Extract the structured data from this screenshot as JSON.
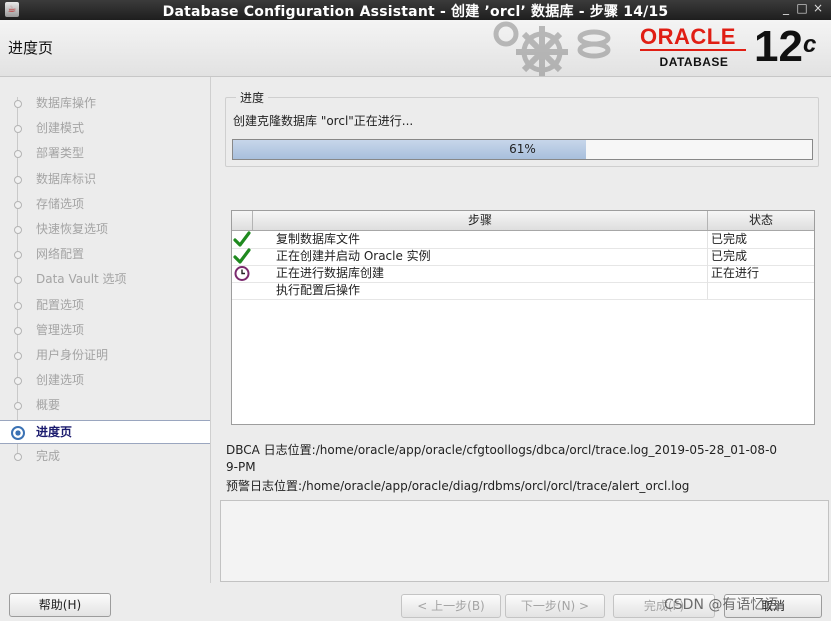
{
  "window": {
    "title": "Database Configuration Assistant - 创建 ’orcl’ 数据库 - 步骤 14/15",
    "min": "_",
    "max": "□",
    "close": "×"
  },
  "header": {
    "page_title": "进度页",
    "brand": "ORACLE",
    "product": "DATABASE",
    "version": "12",
    "version_suffix": "c"
  },
  "sidebar": {
    "items": [
      {
        "label": "数据库操作"
      },
      {
        "label": "创建模式"
      },
      {
        "label": "部署类型"
      },
      {
        "label": "数据库标识"
      },
      {
        "label": "存储选项"
      },
      {
        "label": "快速恢复选项"
      },
      {
        "label": "网络配置"
      },
      {
        "label": "Data Vault 选项"
      },
      {
        "label": "配置选项"
      },
      {
        "label": "管理选项"
      },
      {
        "label": "用户身份证明"
      },
      {
        "label": "创建选项"
      },
      {
        "label": "概要"
      },
      {
        "label": "进度页"
      },
      {
        "label": "完成"
      }
    ],
    "active_index": 13
  },
  "progress": {
    "legend": "进度",
    "status": "创建克隆数据库 \"orcl\"正在进行...",
    "percent_label": "61%",
    "fraction": 0.61
  },
  "steps_table": {
    "headers": {
      "step": "步骤",
      "status": "状态"
    },
    "rows": [
      {
        "name": "复制数据库文件",
        "status": "已完成",
        "icon": "check-icon"
      },
      {
        "name": "正在创建并启动 Oracle 实例",
        "status": "已完成",
        "icon": "check-icon"
      },
      {
        "name": "正在进行数据库创建",
        "status": "正在进行",
        "icon": "clock-icon"
      },
      {
        "name": "执行配置后操作",
        "status": "",
        "icon": ""
      }
    ]
  },
  "logs": {
    "dbca_line1": "DBCA 日志位置:/home/oracle/app/oracle/cfgtoollogs/dbca/orcl/trace.log_2019-05-28_01-08-0",
    "dbca_line2": "9-PM",
    "alert": "预警日志位置:/home/oracle/app/oracle/diag/rdbms/orcl/orcl/trace/alert_orcl.log"
  },
  "footer": {
    "help": "帮助(H)",
    "back": "< 上一步(B)",
    "next": "下一步(N) >",
    "finish": "完成(F)",
    "cancel": "取消"
  },
  "watermark": "CSDN @有语忆语",
  "colors": {
    "oracle_red": "#e01e14",
    "progress_fill": "#a8bfdc",
    "active_text": "#1b1b6e"
  }
}
